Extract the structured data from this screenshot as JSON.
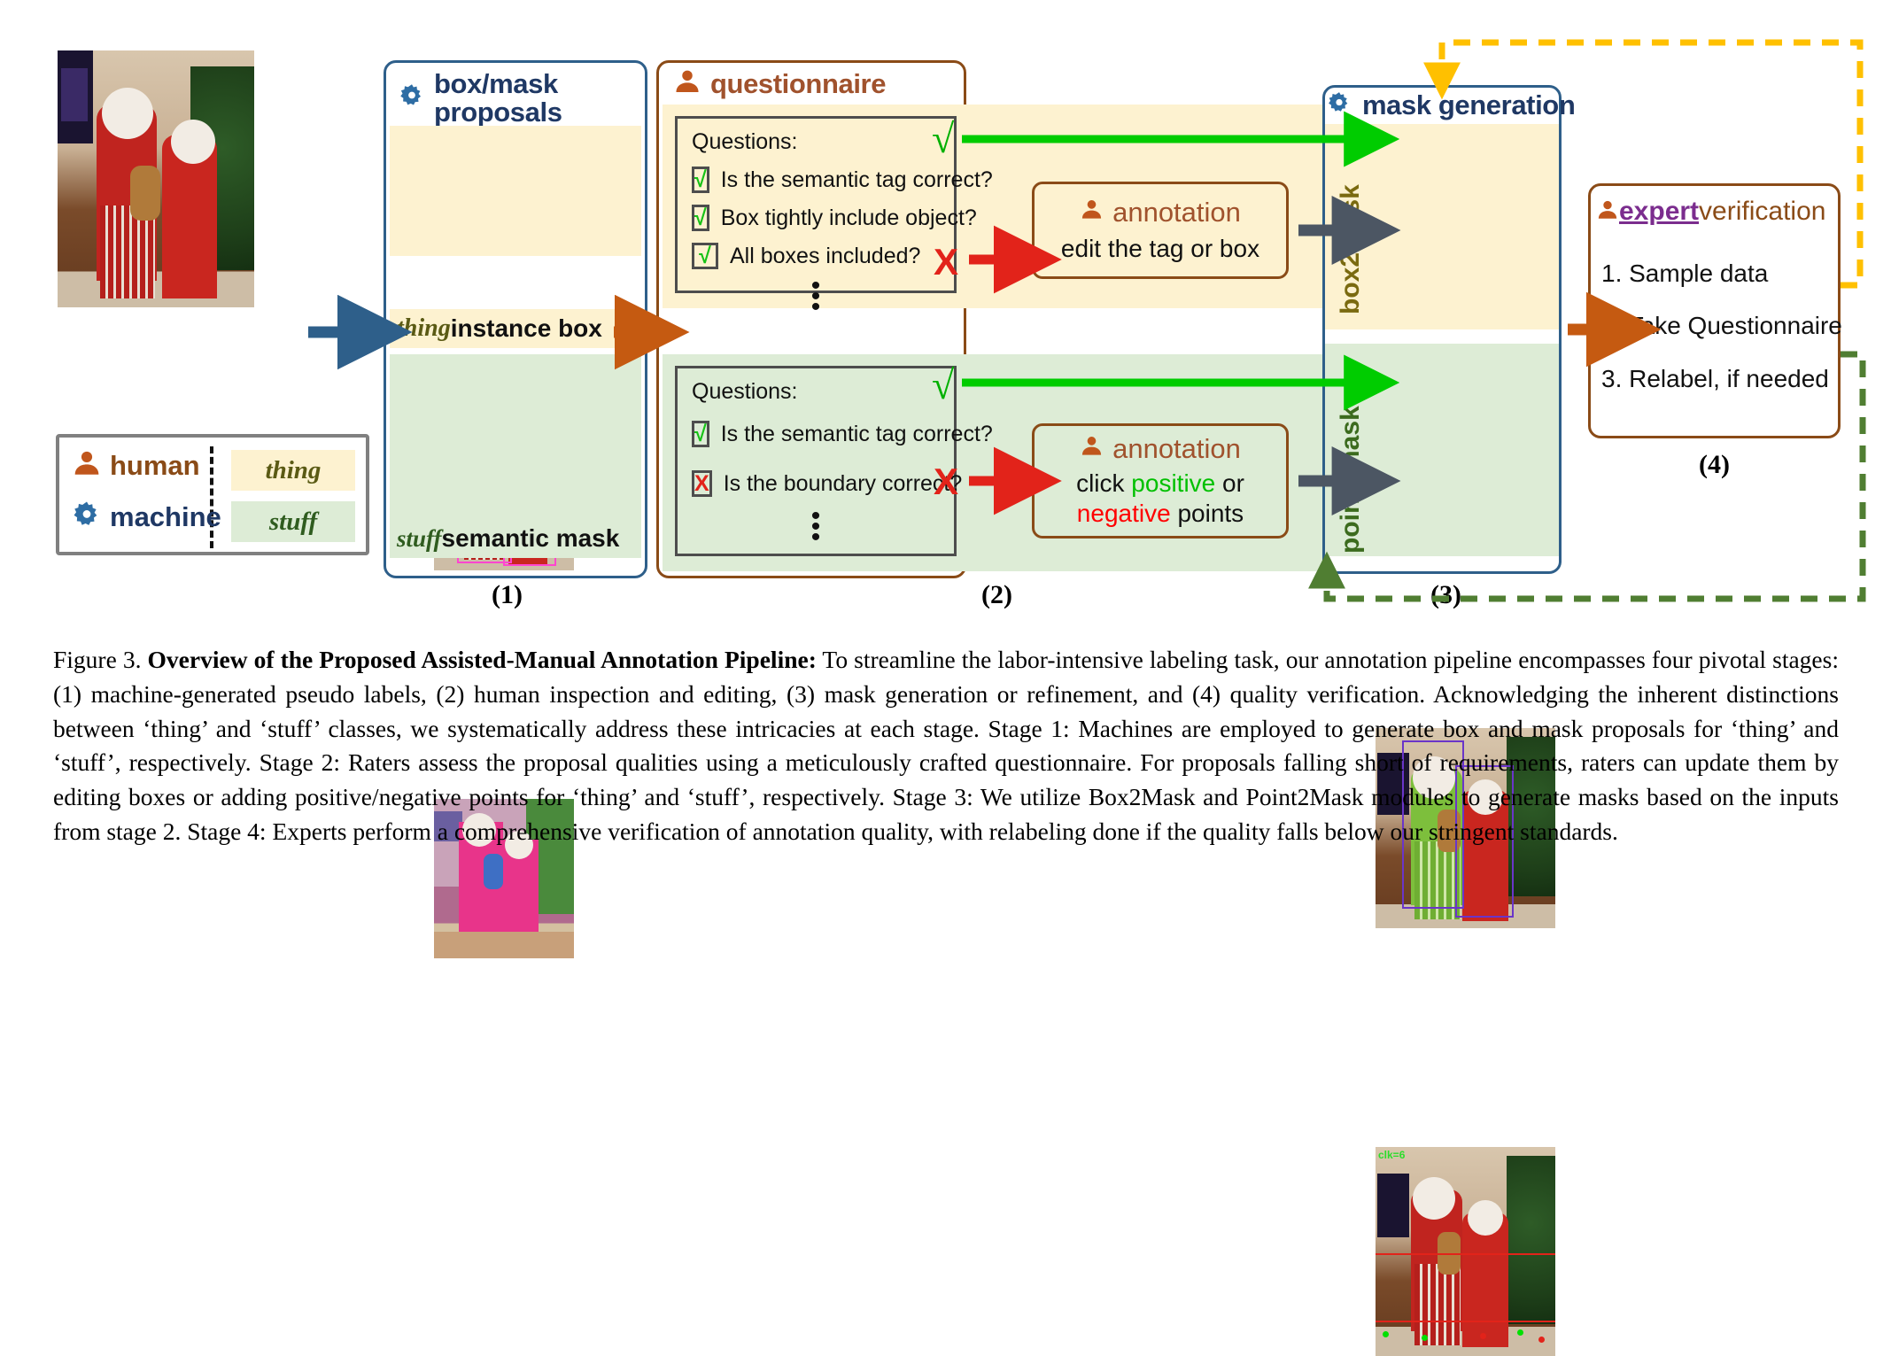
{
  "stage1": {
    "title": "box/mask\nproposals",
    "title_line1": "box/mask",
    "title_line2": "proposals",
    "icon": "gear-icon",
    "thing_caption_italic": "thing",
    "thing_caption_rest": " instance box",
    "stuff_caption_italic": "stuff",
    "stuff_caption_rest": " semantic mask",
    "number": "(1)",
    "photo_tags": [
      "person",
      "tv",
      "teddy bear",
      "person"
    ]
  },
  "stage2": {
    "title": "questionnaire",
    "icon": "person-icon",
    "thing_card": {
      "heading": "Questions:",
      "items": [
        {
          "mark": "√",
          "state": "ok",
          "text": "Is the semantic tag correct?"
        },
        {
          "mark": "√",
          "state": "ok",
          "text": "Box tightly include object?"
        },
        {
          "mark": "√",
          "state": "ok",
          "text": "All boxes included?"
        }
      ],
      "ellipsis": "⋮"
    },
    "stuff_card": {
      "heading": "Questions:",
      "items": [
        {
          "mark": "√",
          "state": "ok",
          "text": "Is the semantic tag correct?"
        },
        {
          "mark": "X",
          "state": "no",
          "text": "Is the boundary correct?"
        }
      ],
      "ellipsis": "⋮"
    },
    "verdict_yes": "√",
    "verdict_no": "X",
    "annotation_thing": {
      "title": "annotation",
      "icon": "person-icon",
      "body": "edit the tag or box"
    },
    "annotation_stuff": {
      "title": "annotation",
      "icon": "person-icon",
      "body_prefix": "click ",
      "body_positive": "positive",
      "body_mid": " or",
      "body_negative": "negative",
      "body_suffix": " points"
    },
    "number": "(2)"
  },
  "stage3": {
    "title": "mask generation",
    "icon": "gear-icon",
    "label_top": "box2mask",
    "label_bottom": "point2mask",
    "photo_tag_clicks": "clk=6",
    "number": "(3)"
  },
  "stage4": {
    "title_icon": "person-icon",
    "title_highlight": "expert",
    "title_rest": " verification",
    "steps": [
      "1. Sample data",
      "2. Take  Questionnaire",
      "3. Relabel, if needed"
    ],
    "number": "(4)"
  },
  "legend": {
    "human_label": "human",
    "human_icon": "person-icon",
    "machine_label": "machine",
    "machine_icon": "gear-icon",
    "thing_chip": "thing",
    "stuff_chip": "stuff"
  },
  "colors": {
    "human": "#c0561c",
    "machine": "#2e6da4",
    "thing_bg": "#fdf2d0",
    "stuff_bg": "#ddecd6",
    "blue_border": "#2e5f8a",
    "brown_border": "#8a4b17",
    "green_arrow": "#00cc00",
    "red_arrow": "#e2231a",
    "gray_arrow": "#4c5663",
    "orange_arrow": "#c55a11",
    "blue_arrow": "#2e5f8a",
    "yellow_dash": "#ffc000",
    "green_dash": "#507e32",
    "expert_purple": "#7b2d8e"
  },
  "caption": {
    "figure_label": "Figure 3. ",
    "bold_title": "Overview of the Proposed Assisted-Manual Annotation Pipeline:",
    "body": " To streamline the labor-intensive labeling task, our annotation pipeline encompasses four pivotal stages: (1) machine-generated pseudo labels, (2) human inspection and editing, (3) mask generation or refinement, and (4) quality verification.  Acknowledging the inherent distinctions between ‘thing’ and ‘stuff’ classes, we systematically address these intricacies at each stage. Stage 1: Machines are employed to generate box and mask proposals for ‘thing’ and ‘stuff’, respectively.  Stage 2: Raters assess the proposal qualities using a meticulously crafted questionnaire.  For proposals falling short of requirements, raters can update them by editing boxes or adding positive/negative points for ‘thing’ and ‘stuff’, respectively. Stage 3: We utilize Box2Mask and Point2Mask modules to generate masks based on the inputs from stage 2. Stage 4: Experts perform a comprehensive verification of annotation quality, with relabeling done if the quality falls below our stringent standards."
  }
}
